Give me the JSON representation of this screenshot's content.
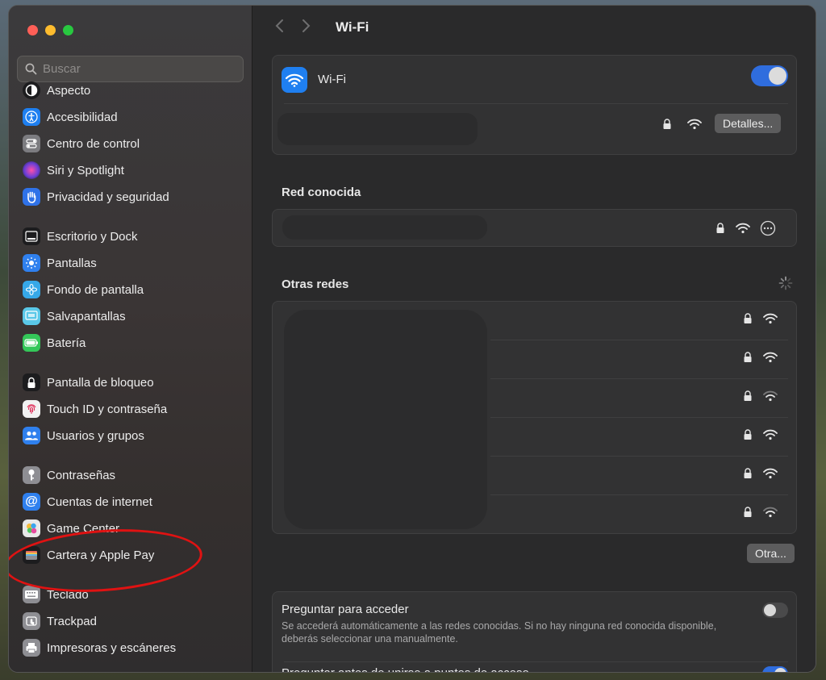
{
  "window": {
    "title": "Wi-Fi"
  },
  "search": {
    "placeholder": "Buscar"
  },
  "sidebar": {
    "items": [
      {
        "label": "Aspecto",
        "icon": "appearance-icon",
        "color": "#1c1c1e"
      },
      {
        "label": "Accesibilidad",
        "icon": "accessibility-icon",
        "color": "#1e7ff0"
      },
      {
        "label": "Centro de control",
        "icon": "control-center-icon",
        "color": "#7c7c80"
      },
      {
        "label": "Siri y Spotlight",
        "icon": "siri-icon",
        "color": "#6b3fd6"
      },
      {
        "label": "Privacidad y seguridad",
        "icon": "hand-icon",
        "color": "#2f72e8"
      },
      {
        "label": "Escritorio y Dock",
        "icon": "dock-icon",
        "color": "#1c1c1e"
      },
      {
        "label": "Pantallas",
        "icon": "sun-icon",
        "color": "#2f80ee"
      },
      {
        "label": "Fondo de pantalla",
        "icon": "flower-icon",
        "color": "#36a8e8"
      },
      {
        "label": "Salvapantallas",
        "icon": "screensaver-icon",
        "color": "#5ac8e8"
      },
      {
        "label": "Batería",
        "icon": "battery-icon",
        "color": "#34c759"
      },
      {
        "label": "Pantalla de bloqueo",
        "icon": "lock-icon",
        "color": "#1c1c1e"
      },
      {
        "label": "Touch ID y contraseña",
        "icon": "fingerprint-icon",
        "color": "#f2f2f2"
      },
      {
        "label": "Usuarios y grupos",
        "icon": "users-icon",
        "color": "#2f80ee"
      },
      {
        "label": "Contraseñas",
        "icon": "key-icon",
        "color": "#8e8e93"
      },
      {
        "label": "Cuentas de internet",
        "icon": "at-icon",
        "color": "#2f80ee"
      },
      {
        "label": "Game Center",
        "icon": "game-center-icon",
        "color": "#e8e8e8"
      },
      {
        "label": "Cartera y Apple Pay",
        "icon": "wallet-icon",
        "color": "#1c1c1e"
      },
      {
        "label": "Teclado",
        "icon": "keyboard-icon",
        "color": "#8e8e93"
      },
      {
        "label": "Trackpad",
        "icon": "trackpad-icon",
        "color": "#8e8e93"
      },
      {
        "label": "Impresoras y escáneres",
        "icon": "printer-icon",
        "color": "#8e8e93"
      }
    ]
  },
  "wifi": {
    "label": "Wi-Fi",
    "enabled": true,
    "details_button": "Detalles..."
  },
  "known": {
    "title": "Red conocida"
  },
  "others": {
    "title": "Otras redes",
    "networks": [
      {
        "strength": "full"
      },
      {
        "strength": "full"
      },
      {
        "strength": "weak"
      },
      {
        "strength": "full"
      },
      {
        "strength": "full"
      },
      {
        "strength": "weak"
      }
    ],
    "other_button": "Otra..."
  },
  "ask_join": {
    "title": "Preguntar para acceder",
    "description": "Se accederá automáticamente a las redes conocidas. Si no hay ninguna red conocida disponible, deberás seleccionar una manualmente.",
    "enabled": false
  },
  "ask_hotspot": {
    "title": "Preguntar antes de unirse a puntos de acceso",
    "enabled": true
  },
  "colors": {
    "accent": "#2f6dde",
    "annotation": "#e01212"
  }
}
